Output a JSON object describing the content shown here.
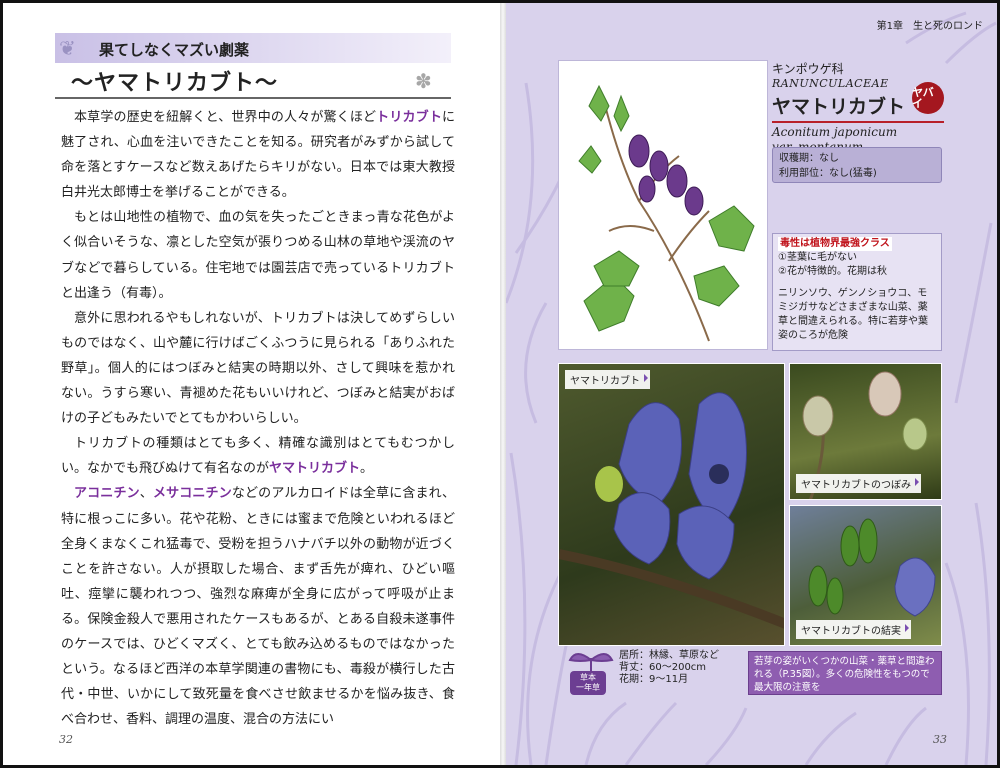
{
  "left_page": {
    "section_header": "果てしなくマズい劇薬",
    "title": "～ヤマトリカブト～",
    "paragraphs": [
      [
        {
          "t": "本草学の歴史を紐解くと、世界中の人々が驚くほど"
        },
        {
          "t": "トリカブト",
          "hl": true
        },
        {
          "t": "に魅了され、心血を注いできたことを知る。研究者がみずから試して命を落とすケースなど数えあげたらキリがない。日本では東大教授白井光太郎博士を挙げることができる。"
        }
      ],
      [
        {
          "t": "もとは山地性の植物で、血の気を失ったごときまっ青な花色がよく似合いそうな、凛とした空気が張りつめる山林の草地や渓流のヤブなどで暮らしている。住宅地では園芸店で売っているトリカブトと出逢う（有毒）。"
        }
      ],
      [
        {
          "t": "意外に思われるやもしれないが、トリカブトは決してめずらしいものではなく、山や麓に行けばごくふつうに見られる「ありふれた野草」。個人的にはつぼみと結実の時期以外、さして興味を惹かれない。うすら寒い、青褪めた花もいいけれど、つぼみと結実がおばけの子どもみたいでとてもかわいらしい。"
        }
      ],
      [
        {
          "t": "トリカブトの種類はとても多く、精確な識別はとてもむつかしい。なかでも飛びぬけて有名なのが"
        },
        {
          "t": "ヤマトリカブト",
          "hl": true
        },
        {
          "t": "。"
        }
      ],
      [
        {
          "t": "アコニチン",
          "hl": true
        },
        {
          "t": "、"
        },
        {
          "t": "メサコニチン",
          "hl": true
        },
        {
          "t": "などのアルカロイドは全草に含まれ、特に根っこに多い。花や花粉、ときには蜜まで危険といわれるほど全身くまなくこれ猛毒で、受粉を担うハナバチ以外の動物が近づくことを許さない。人が摂取した場合、まず舌先が痺れ、ひどい嘔吐、痙攣に襲われつつ、強烈な麻痺が全身に広がって呼吸が止まる。保険金殺人で悪用されたケースもあるが、とある自殺未遂事件のケースでは、ひどくマズく、とても飲み込めるものではなかったという。なるほど西洋の本草学関連の書物にも、毒殺が横行した古代・中世、いかにして致死量を食べさせ飲ませるかを悩み抜き、食べ合わせ、香料、調理の温度、混合の方法にい"
        }
      ]
    ],
    "page_number": "32"
  },
  "right_page": {
    "chapter_label": "第1章　生と死のロンド",
    "family_kana": "キンポウゲ科",
    "family_latin": "RANUNCULACEAE",
    "plant_name": "ヤマトリカブト",
    "badge": "ヤバイ",
    "scientific_name_1": "Aconitum japonicum",
    "scientific_name_2": "var. montanum",
    "harvest": "収穫期：なし",
    "usage": "利用部位：なし(猛毒)",
    "toxicity_title": "毒性は植物界最強クラス",
    "feature_1": "①茎葉に毛がない",
    "feature_2": "②花が特徴的。花期は秋",
    "confusion_note": "ニリンソウ、ゲンノショウコ、モミジガサなどさまざまな山菜、薬草と間違えられる。特に若芽や葉姿のころが危険",
    "photo_captions": [
      "ヤマトリカブト",
      "ヤマトリカブトのつぼみ",
      "ヤマトリカブトの結実"
    ],
    "habitat": "居所：林縁、草原など",
    "height": "背丈：60～200cm",
    "flowering": "花期：9～11月",
    "category_label": "草本",
    "category_sub": "一年草",
    "bottom_note": "若芽の姿がいくつかの山菜・薬草と間違われる（P.35図）。多くの危険性をもつので最大限の注意を",
    "page_number": "33",
    "colors": {
      "accent": "#7a2f9c",
      "badge": "#a4171f",
      "page_bg": "#d9d2ec"
    }
  }
}
